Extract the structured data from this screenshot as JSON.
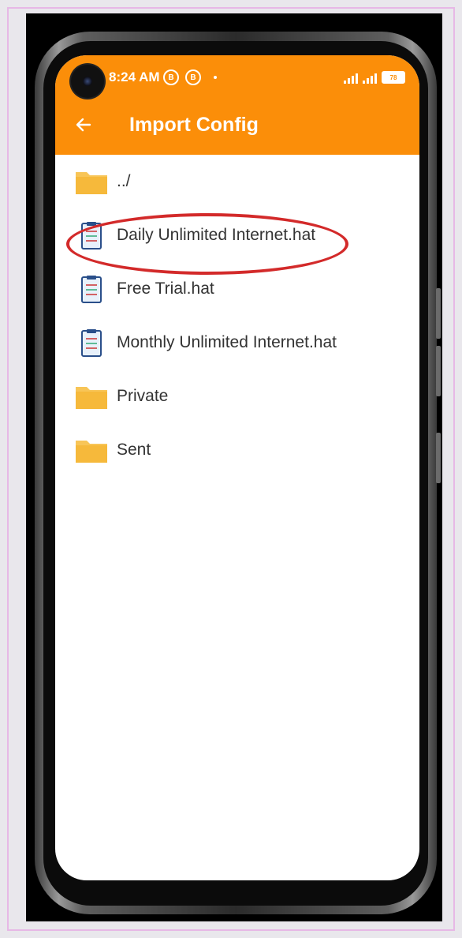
{
  "status_bar": {
    "time": "8:24 AM",
    "badge_1": "B",
    "badge_2": "B",
    "battery": "78"
  },
  "header": {
    "title": "Import Config",
    "background_color": "#fb8e09"
  },
  "file_list": [
    {
      "label": "../",
      "icon": "folder-icon"
    },
    {
      "label": "Daily Unlimited Internet.hat",
      "icon": "clipboard-file-icon",
      "highlighted": true
    },
    {
      "label": "Free Trial.hat",
      "icon": "clipboard-file-icon"
    },
    {
      "label": "Monthly Unlimited Internet.hat",
      "icon": "clipboard-file-icon"
    },
    {
      "label": "Private",
      "icon": "folder-icon"
    },
    {
      "label": "Sent",
      "icon": "folder-icon"
    }
  ],
  "colors": {
    "accent": "#fb8e09",
    "folder": "#f8c557",
    "highlight": "#d32a2a"
  }
}
